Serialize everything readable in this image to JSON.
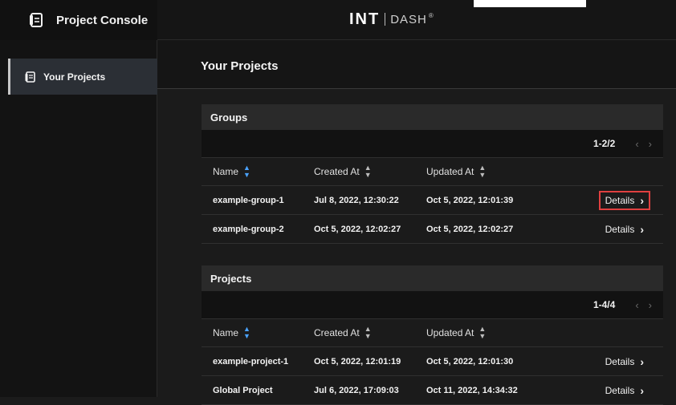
{
  "header": {
    "app_title": "Project Console",
    "brand_main": "INT",
    "brand_sub": "DASH",
    "brand_mark": "®"
  },
  "sidebar": {
    "items": [
      {
        "label": "Your Projects",
        "icon": "documents-icon",
        "active": true
      }
    ]
  },
  "page": {
    "title": "Your Projects"
  },
  "groups": {
    "title": "Groups",
    "pager": "1-2/2",
    "prev": "‹",
    "next": "›",
    "columns": {
      "name": "Name",
      "created": "Created At",
      "updated": "Updated At"
    },
    "sort_up": "▲",
    "sort_down": "▼",
    "rows": [
      {
        "name": "example-group-1",
        "created": "Jul 8, 2022, 12:30:22",
        "updated": "Oct 5, 2022, 12:01:39",
        "action": "Details"
      },
      {
        "name": "example-group-2",
        "created": "Oct 5, 2022, 12:02:27",
        "updated": "Oct 5, 2022, 12:02:27",
        "action": "Details"
      }
    ]
  },
  "projects": {
    "title": "Projects",
    "pager": "1-4/4",
    "prev": "‹",
    "next": "›",
    "columns": {
      "name": "Name",
      "created": "Created At",
      "updated": "Updated At"
    },
    "sort_up": "▲",
    "sort_down": "▼",
    "rows": [
      {
        "name": "example-project-1",
        "created": "Oct 5, 2022, 12:01:19",
        "updated": "Oct 5, 2022, 12:01:30",
        "action": "Details"
      },
      {
        "name": "Global Project",
        "created": "Jul 6, 2022, 17:09:03",
        "updated": "Oct 11, 2022, 14:34:32",
        "action": "Details"
      }
    ]
  },
  "colors": {
    "sort_active": "#4aa3ff",
    "highlight_border": "#e04040",
    "nav_active_bg": "#2b2f35"
  }
}
